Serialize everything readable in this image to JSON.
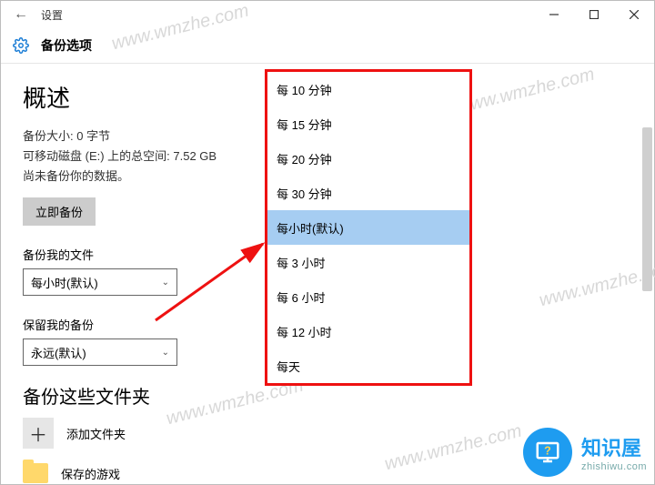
{
  "titlebar": {
    "back_icon": "←",
    "title": "设置"
  },
  "header": {
    "icon": "gear",
    "label": "备份选项"
  },
  "overview": {
    "heading": "概述",
    "size_line": "备份大小: 0 字节",
    "drive_line": "可移动磁盘 (E:) 上的总空间: 7.52 GB",
    "status_line": "尚未备份你的数据。",
    "backup_now_btn": "立即备份"
  },
  "backup_files": {
    "label": "备份我的文件",
    "selected": "每小时(默认)",
    "options": [
      "每 10 分钟",
      "每 15 分钟",
      "每 20 分钟",
      "每 30 分钟",
      "每小时(默认)",
      "每 3 小时",
      "每 6 小时",
      "每 12 小时",
      "每天"
    ],
    "selected_index": 4
  },
  "keep_backups": {
    "label": "保留我的备份",
    "selected": "永远(默认)"
  },
  "folders": {
    "heading": "备份这些文件夹",
    "add_label": "添加文件夹",
    "items": [
      {
        "name": "保存的游戏"
      }
    ]
  },
  "watermark": "www.wmzhe.com",
  "badge": {
    "title": "知识屋",
    "sub": "zhishiwu.com"
  }
}
